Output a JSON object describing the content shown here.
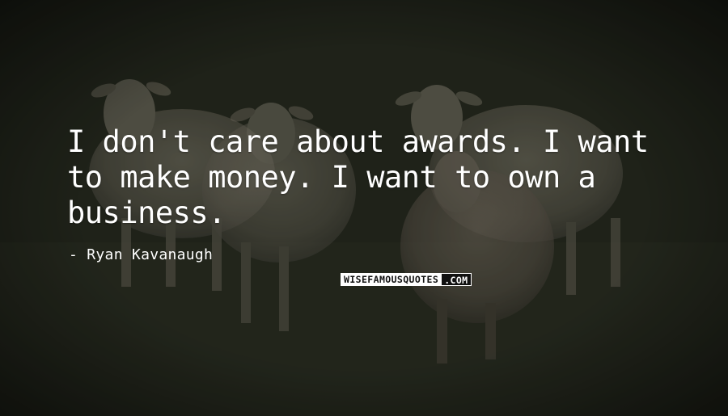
{
  "quote": {
    "text": "I don't care about awards. I want to make money. I want to own a business.",
    "author": "Ryan Kavanaugh"
  },
  "watermark": {
    "main": "WISEFAMOUSQUOTES",
    "tld": ".COM"
  },
  "colors": {
    "text": "#ffffff",
    "grass_dark": "#1f2319",
    "grass_mid": "#3a3d2f",
    "sheep_wool": "#8a8576"
  },
  "image": {
    "subject-icon": "sheep-in-field"
  }
}
